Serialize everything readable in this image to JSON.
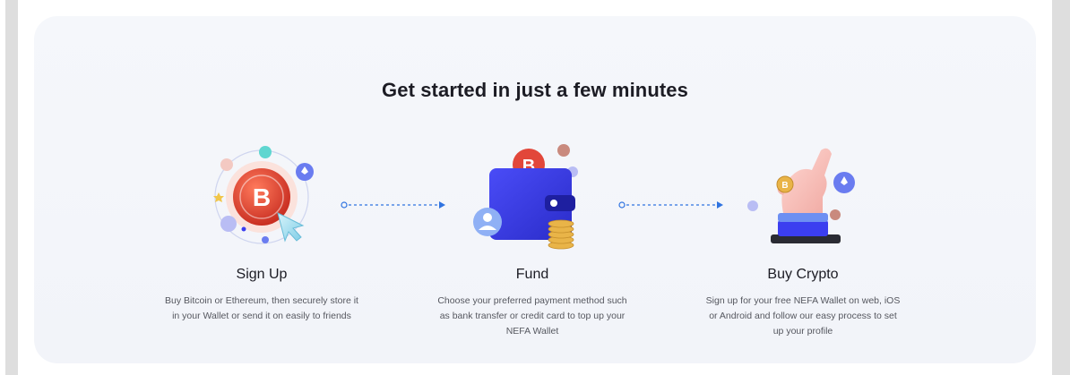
{
  "heading": "Get started in just a few minutes",
  "colors": {
    "accent_blue": "#2f73e0",
    "bitcoin_red": "#e2473a",
    "wallet_blue": "#3b3ef0",
    "gold": "#e9b448"
  },
  "steps": [
    {
      "title": "Sign Up",
      "description": "Buy Bitcoin or Ethereum, then securely store it in your Wallet or send it on easily to friends",
      "icon": "bitcoin-orbit-cursor-icon"
    },
    {
      "title": "Fund",
      "description": "Choose your preferred payment method such as bank transfer or credit card to top up your NEFA Wallet",
      "icon": "wallet-coins-icon"
    },
    {
      "title": "Buy Crypto",
      "description": "Sign up for your free NEFA Wallet on web, iOS or Android and follow our easy process to set up your profile",
      "icon": "hand-coin-icon"
    }
  ]
}
